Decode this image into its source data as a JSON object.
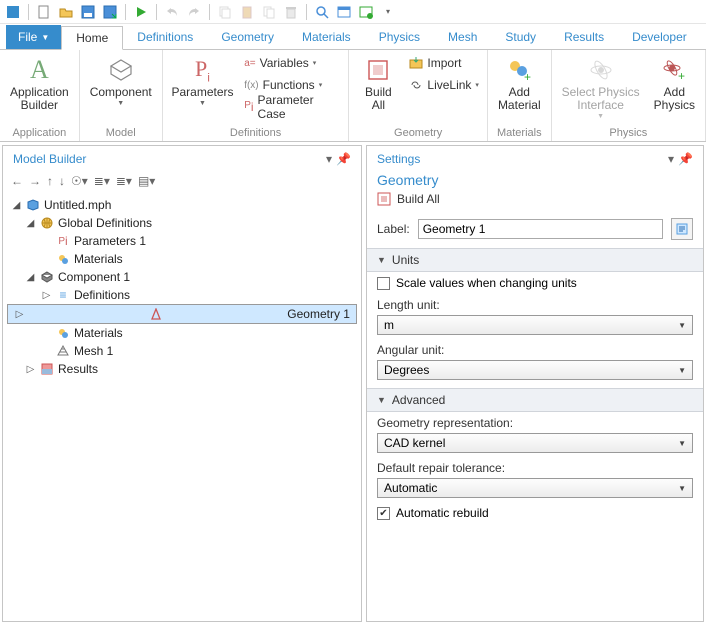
{
  "file_menu": "File",
  "tabs": [
    "Home",
    "Definitions",
    "Geometry",
    "Materials",
    "Physics",
    "Mesh",
    "Study",
    "Results",
    "Developer"
  ],
  "ribbon": {
    "application": {
      "label": "Application",
      "btn": "Application\nBuilder"
    },
    "model": {
      "label": "Model",
      "btn": "Component"
    },
    "definitions": {
      "label": "Definitions",
      "parameters": "Parameters",
      "variables": "Variables",
      "functions": "Functions",
      "paramcase": "Parameter Case"
    },
    "geometry": {
      "label": "Geometry",
      "buildall": "Build\nAll",
      "import": "Import",
      "livelink": "LiveLink"
    },
    "materials": {
      "label": "Materials",
      "btn": "Add\nMaterial"
    },
    "physics": {
      "label": "Physics",
      "select": "Select Physics\nInterface",
      "add": "Add\nPhysics"
    }
  },
  "model_builder": {
    "title": "Model Builder",
    "tree": {
      "root": "Untitled.mph",
      "global": "Global Definitions",
      "params1": "Parameters 1",
      "materials": "Materials",
      "comp1": "Component 1",
      "defs": "Definitions",
      "geom1": "Geometry 1",
      "mesh1": "Mesh 1",
      "results": "Results"
    }
  },
  "settings": {
    "title": "Settings",
    "subtitle": "Geometry",
    "build_all": "Build All",
    "label_lbl": "Label:",
    "label_val": "Geometry 1",
    "units": {
      "header": "Units",
      "scale": "Scale values when changing units",
      "length_lbl": "Length unit:",
      "length_val": "m",
      "angular_lbl": "Angular unit:",
      "angular_val": "Degrees"
    },
    "advanced": {
      "header": "Advanced",
      "repr_lbl": "Geometry representation:",
      "repr_val": "CAD kernel",
      "tol_lbl": "Default repair tolerance:",
      "tol_val": "Automatic",
      "auto_rebuild": "Automatic rebuild"
    }
  }
}
